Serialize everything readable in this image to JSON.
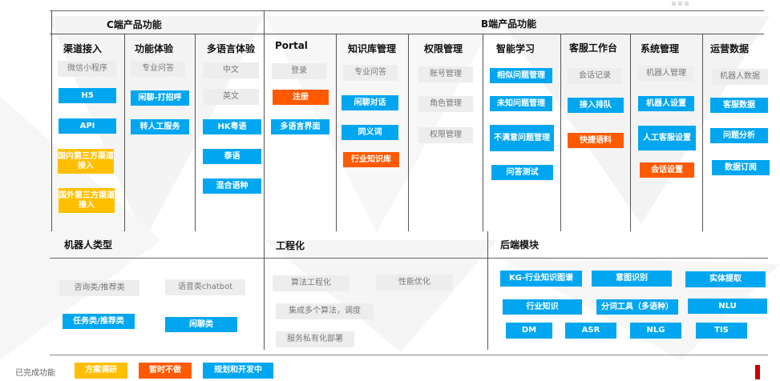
{
  "c_section": {
    "title": "C端产品功能",
    "columns": [
      {
        "header": "渠道接入",
        "items": [
          {
            "label": "微信小程序",
            "status": "done"
          },
          {
            "label": "H5",
            "status": "dev"
          },
          {
            "label": "API",
            "status": "dev"
          },
          {
            "label": "国内第三方渠道接入",
            "status": "research"
          },
          {
            "label": "国外第三方渠道接入",
            "status": "research"
          }
        ]
      },
      {
        "header": "功能体验",
        "items": [
          {
            "label": "专业问答",
            "status": "done"
          },
          {
            "label": "闲聊-打招呼",
            "status": "dev"
          },
          {
            "label": "转人工服务",
            "status": "dev"
          }
        ]
      },
      {
        "header": "多语言体验",
        "items": [
          {
            "label": "中文",
            "status": "done"
          },
          {
            "label": "英文",
            "status": "done"
          },
          {
            "label": "HK粤语",
            "status": "dev"
          },
          {
            "label": "泰语",
            "status": "dev"
          },
          {
            "label": "混合语种",
            "status": "dev"
          }
        ]
      }
    ]
  },
  "b_section": {
    "title": "B端产品功能",
    "columns": [
      {
        "header": "Portal",
        "items": [
          {
            "label": "登录",
            "status": "done"
          },
          {
            "label": "注册",
            "status": "skip"
          },
          {
            "label": "多语言界面",
            "status": "dev"
          }
        ]
      },
      {
        "header": "知识库管理",
        "items": [
          {
            "label": "专业问答",
            "status": "done"
          },
          {
            "label": "闲聊对话",
            "status": "dev"
          },
          {
            "label": "同义词",
            "status": "dev"
          },
          {
            "label": "行业知识库",
            "status": "skip"
          }
        ]
      },
      {
        "header": "权限管理",
        "items": [
          {
            "label": "账号管理",
            "status": "done"
          },
          {
            "label": "角色管理",
            "status": "done"
          },
          {
            "label": "权限管理",
            "status": "done"
          }
        ]
      },
      {
        "header": "智能学习",
        "items": [
          {
            "label": "相似问题管理",
            "status": "dev"
          },
          {
            "label": "未知问题管理",
            "status": "dev"
          },
          {
            "label": "不满意问题管理",
            "status": "dev"
          },
          {
            "label": "问答测试",
            "status": "dev"
          }
        ]
      },
      {
        "header": "客服工作台",
        "items": [
          {
            "label": "会话记录",
            "status": "done"
          },
          {
            "label": "接入排队",
            "status": "dev"
          },
          {
            "label": "快捷语料",
            "status": "skip"
          }
        ]
      },
      {
        "header": "系统管理",
        "items": [
          {
            "label": "机器人管理",
            "status": "done"
          },
          {
            "label": "机器人设置",
            "status": "dev"
          },
          {
            "label": "人工客服设置",
            "status": "dev"
          },
          {
            "label": "会话设置",
            "status": "skip"
          }
        ]
      },
      {
        "header": "运营数据",
        "items": [
          {
            "label": "机器人数据",
            "status": "done"
          },
          {
            "label": "客服数据",
            "status": "dev"
          },
          {
            "label": "问题分析",
            "status": "dev"
          },
          {
            "label": "数据订阅",
            "status": "dev"
          }
        ]
      }
    ]
  },
  "robot_types": {
    "title": "机器人类型",
    "items": [
      {
        "label": "咨询类/推荐类",
        "status": "done"
      },
      {
        "label": "语音类chatbot",
        "status": "done"
      },
      {
        "label": "任务类/推荐类",
        "status": "dev"
      },
      {
        "label": "闲聊类",
        "status": "dev"
      }
    ]
  },
  "engineering": {
    "title": "工程化",
    "items": [
      {
        "label": "算法工程化",
        "status": "done"
      },
      {
        "label": "性能优化",
        "status": "done"
      },
      {
        "label": "集成多个算法，调度",
        "status": "done"
      },
      {
        "label": "服务私有化部署",
        "status": "done"
      }
    ]
  },
  "backend": {
    "title": "后端模块",
    "items": [
      {
        "label": "KG-行业知识图谱",
        "status": "dev"
      },
      {
        "label": "意图识别",
        "status": "dev"
      },
      {
        "label": "实体提取",
        "status": "dev"
      },
      {
        "label": "行业知识",
        "status": "dev"
      },
      {
        "label": "分词工具（多语种）",
        "status": "dev"
      },
      {
        "label": "NLU",
        "status": "dev"
      },
      {
        "label": "DM",
        "status": "dev"
      },
      {
        "label": "ASR",
        "status": "dev"
      },
      {
        "label": "NLG",
        "status": "dev"
      },
      {
        "label": "TIS",
        "status": "dev"
      }
    ]
  },
  "legend": {
    "done": "已完成功能",
    "research": "方案调研",
    "skip": "暂时不做",
    "dev": "规划和开发中"
  },
  "colors": {
    "done_bg": "#ededed",
    "research": "#ffbf00",
    "skip": "#ff5a00",
    "dev": "#00a6ef",
    "accent": "#cc0000"
  }
}
